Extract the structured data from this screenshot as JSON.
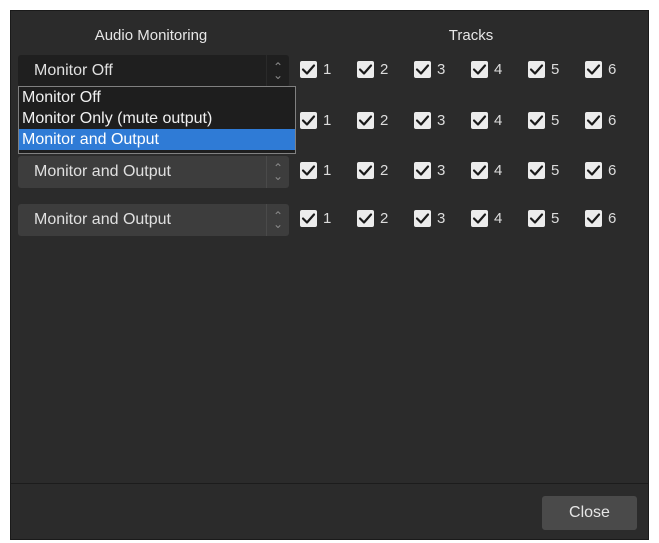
{
  "headers": {
    "audio_monitoring": "Audio Monitoring",
    "tracks": "Tracks"
  },
  "rows": [
    {
      "monitoring": "Monitor Off",
      "tracks": [
        "1",
        "2",
        "3",
        "4",
        "5",
        "6"
      ],
      "checked": [
        true,
        true,
        true,
        true,
        true,
        true
      ]
    },
    {
      "monitoring": "",
      "tracks": [
        "1",
        "2",
        "3",
        "4",
        "5",
        "6"
      ],
      "checked": [
        true,
        true,
        true,
        true,
        true,
        true
      ]
    },
    {
      "monitoring": "Monitor and Output",
      "tracks": [
        "1",
        "2",
        "3",
        "4",
        "5",
        "6"
      ],
      "checked": [
        true,
        true,
        true,
        true,
        true,
        true
      ]
    },
    {
      "monitoring": "Monitor and Output",
      "tracks": [
        "1",
        "2",
        "3",
        "4",
        "5",
        "6"
      ],
      "checked": [
        true,
        true,
        true,
        true,
        true,
        true
      ]
    }
  ],
  "dropdown": {
    "options": [
      "Monitor Off",
      "Monitor Only (mute output)",
      "Monitor and Output"
    ],
    "selected": "Monitor and Output"
  },
  "close_label": "Close",
  "colors": {
    "background": "#2b2b2b",
    "highlight": "#2f7bd6",
    "checkbox": "#ececec"
  },
  "icons": {
    "checkbox": "checkmark-icon",
    "spinner": "up-down-arrows-icon"
  }
}
